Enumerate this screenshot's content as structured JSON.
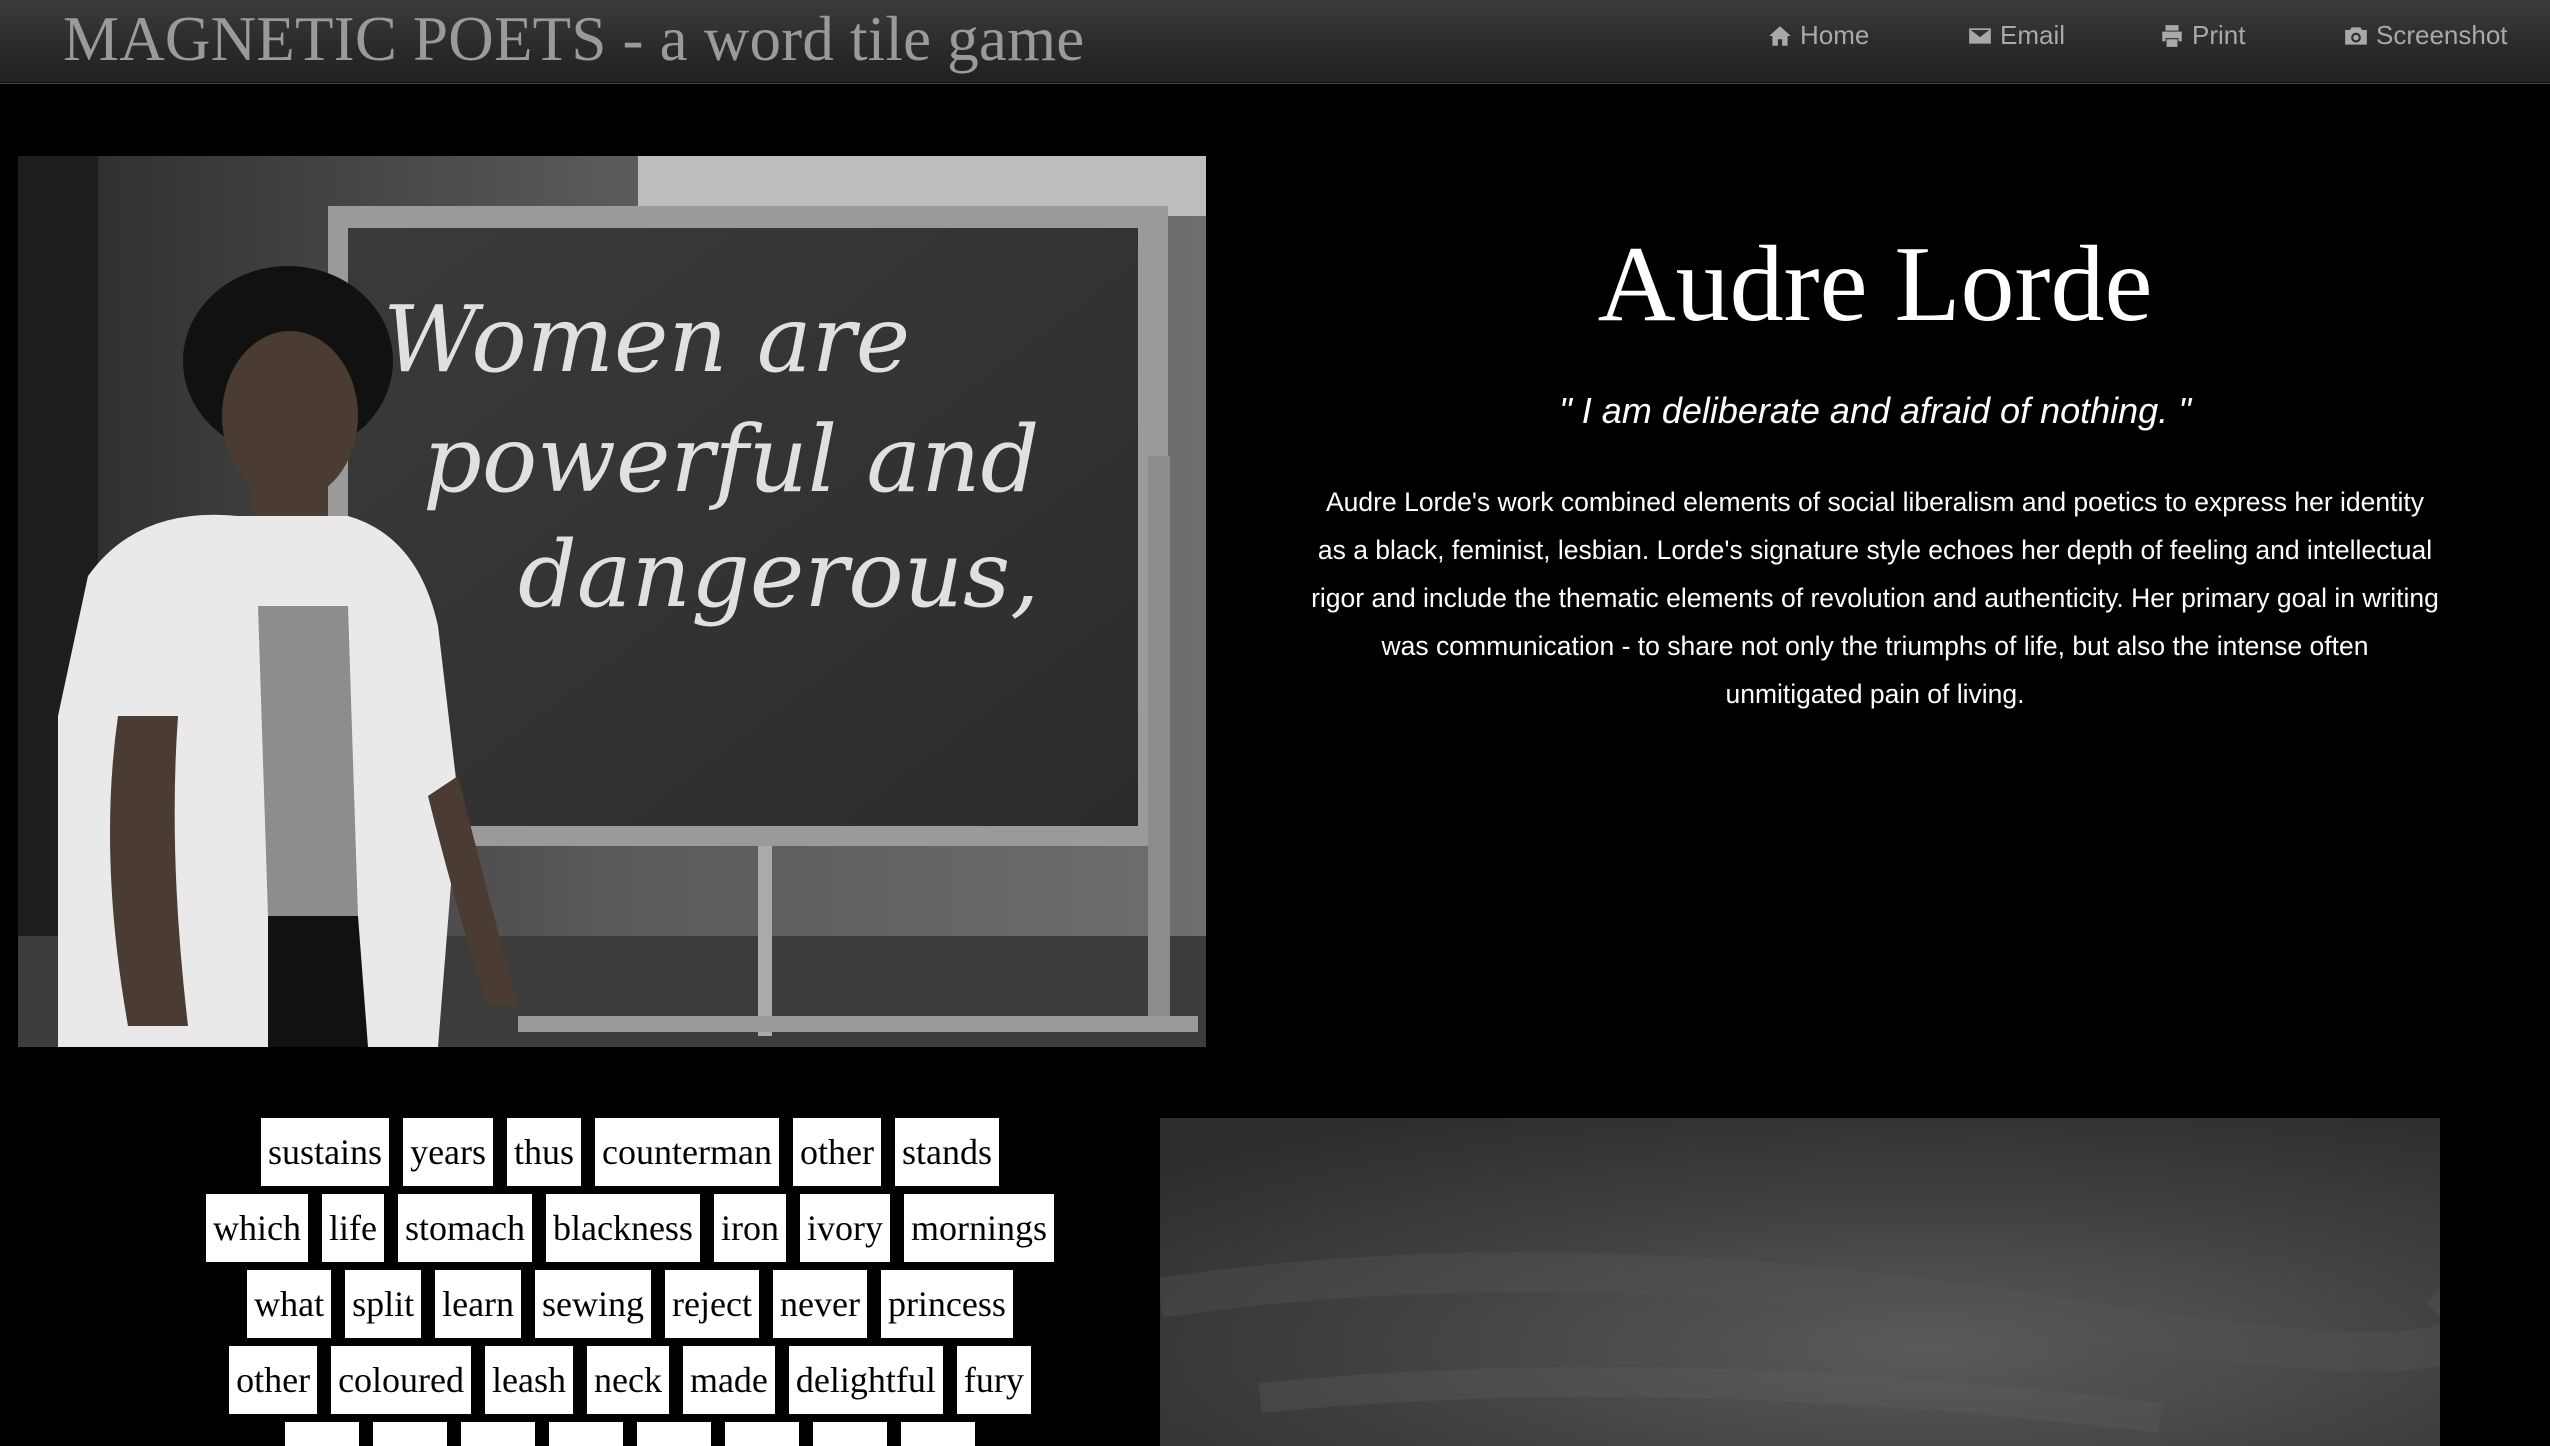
{
  "navbar": {
    "brand": "MAGNETIC POETS - a word tile game",
    "links": [
      {
        "label": "Home",
        "icon": "home-icon"
      },
      {
        "label": "Email",
        "icon": "envelope-icon"
      },
      {
        "label": "Print",
        "icon": "print-icon"
      },
      {
        "label": "Screenshot",
        "icon": "camera-icon"
      }
    ]
  },
  "photo": {
    "chalkboard_text": [
      "Women are",
      "powerful and",
      "dangerous,"
    ]
  },
  "poet": {
    "name": "Audre Lorde",
    "quote": "\" I am deliberate and afraid of nothing. \"",
    "bio": "Audre Lorde's work combined elements of social liberalism and poetics to express her identity as a black, feminist, lesbian. Lorde's signature style echoes her depth of feeling and intellectual rigor and include the thematic elements of revolution and authenticity. Her primary goal in writing was communication - to share not only the triumphs of life, but also the intense often unmitigated pain of living."
  },
  "tiles": [
    [
      "sustains",
      "years",
      "thus",
      "counterman",
      "other",
      "stands"
    ],
    [
      "which",
      "life",
      "stomach",
      "blackness",
      "iron",
      "ivory",
      "mornings"
    ],
    [
      "what",
      "split",
      "learn",
      "sewing",
      "reject",
      "never",
      "princess"
    ],
    [
      "other",
      "coloured",
      "leash",
      "neck",
      "made",
      "delightful",
      "fury"
    ],
    [
      "",
      "",
      "",
      "",
      "",
      "",
      "",
      ""
    ]
  ],
  "colors": {
    "background": "#000000",
    "navbar": "#2b2b2b",
    "nav_text": "#a9a9a9",
    "brand_text": "#9a9a9a",
    "tile_bg": "#ffffff",
    "tile_text": "#000000",
    "chalkboard": "#3a3a3a"
  }
}
